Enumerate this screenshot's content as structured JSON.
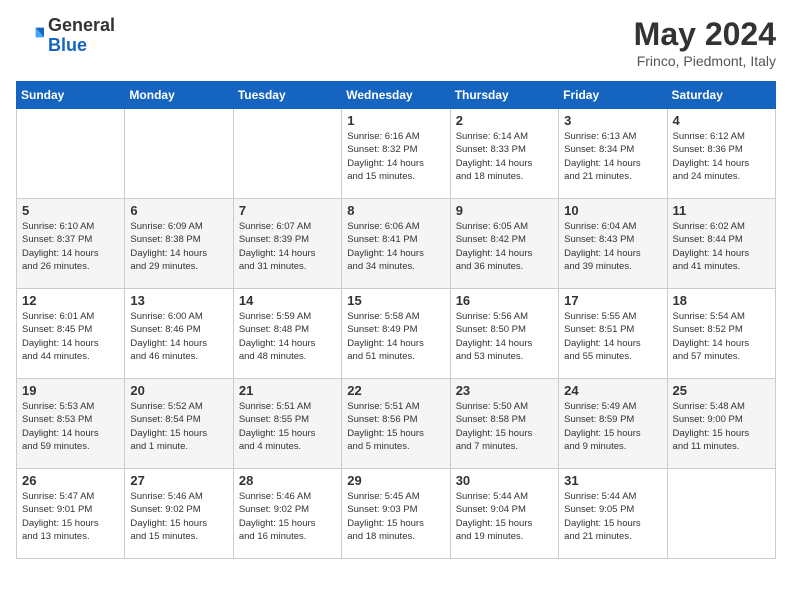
{
  "header": {
    "logo_general": "General",
    "logo_blue": "Blue",
    "month_title": "May 2024",
    "location": "Frinco, Piedmont, Italy"
  },
  "weekdays": [
    "Sunday",
    "Monday",
    "Tuesday",
    "Wednesday",
    "Thursday",
    "Friday",
    "Saturday"
  ],
  "weeks": [
    [
      {
        "day": "",
        "info": ""
      },
      {
        "day": "",
        "info": ""
      },
      {
        "day": "",
        "info": ""
      },
      {
        "day": "1",
        "info": "Sunrise: 6:16 AM\nSunset: 8:32 PM\nDaylight: 14 hours\nand 15 minutes."
      },
      {
        "day": "2",
        "info": "Sunrise: 6:14 AM\nSunset: 8:33 PM\nDaylight: 14 hours\nand 18 minutes."
      },
      {
        "day": "3",
        "info": "Sunrise: 6:13 AM\nSunset: 8:34 PM\nDaylight: 14 hours\nand 21 minutes."
      },
      {
        "day": "4",
        "info": "Sunrise: 6:12 AM\nSunset: 8:36 PM\nDaylight: 14 hours\nand 24 minutes."
      }
    ],
    [
      {
        "day": "5",
        "info": "Sunrise: 6:10 AM\nSunset: 8:37 PM\nDaylight: 14 hours\nand 26 minutes."
      },
      {
        "day": "6",
        "info": "Sunrise: 6:09 AM\nSunset: 8:38 PM\nDaylight: 14 hours\nand 29 minutes."
      },
      {
        "day": "7",
        "info": "Sunrise: 6:07 AM\nSunset: 8:39 PM\nDaylight: 14 hours\nand 31 minutes."
      },
      {
        "day": "8",
        "info": "Sunrise: 6:06 AM\nSunset: 8:41 PM\nDaylight: 14 hours\nand 34 minutes."
      },
      {
        "day": "9",
        "info": "Sunrise: 6:05 AM\nSunset: 8:42 PM\nDaylight: 14 hours\nand 36 minutes."
      },
      {
        "day": "10",
        "info": "Sunrise: 6:04 AM\nSunset: 8:43 PM\nDaylight: 14 hours\nand 39 minutes."
      },
      {
        "day": "11",
        "info": "Sunrise: 6:02 AM\nSunset: 8:44 PM\nDaylight: 14 hours\nand 41 minutes."
      }
    ],
    [
      {
        "day": "12",
        "info": "Sunrise: 6:01 AM\nSunset: 8:45 PM\nDaylight: 14 hours\nand 44 minutes."
      },
      {
        "day": "13",
        "info": "Sunrise: 6:00 AM\nSunset: 8:46 PM\nDaylight: 14 hours\nand 46 minutes."
      },
      {
        "day": "14",
        "info": "Sunrise: 5:59 AM\nSunset: 8:48 PM\nDaylight: 14 hours\nand 48 minutes."
      },
      {
        "day": "15",
        "info": "Sunrise: 5:58 AM\nSunset: 8:49 PM\nDaylight: 14 hours\nand 51 minutes."
      },
      {
        "day": "16",
        "info": "Sunrise: 5:56 AM\nSunset: 8:50 PM\nDaylight: 14 hours\nand 53 minutes."
      },
      {
        "day": "17",
        "info": "Sunrise: 5:55 AM\nSunset: 8:51 PM\nDaylight: 14 hours\nand 55 minutes."
      },
      {
        "day": "18",
        "info": "Sunrise: 5:54 AM\nSunset: 8:52 PM\nDaylight: 14 hours\nand 57 minutes."
      }
    ],
    [
      {
        "day": "19",
        "info": "Sunrise: 5:53 AM\nSunset: 8:53 PM\nDaylight: 14 hours\nand 59 minutes."
      },
      {
        "day": "20",
        "info": "Sunrise: 5:52 AM\nSunset: 8:54 PM\nDaylight: 15 hours\nand 1 minute."
      },
      {
        "day": "21",
        "info": "Sunrise: 5:51 AM\nSunset: 8:55 PM\nDaylight: 15 hours\nand 4 minutes."
      },
      {
        "day": "22",
        "info": "Sunrise: 5:51 AM\nSunset: 8:56 PM\nDaylight: 15 hours\nand 5 minutes."
      },
      {
        "day": "23",
        "info": "Sunrise: 5:50 AM\nSunset: 8:58 PM\nDaylight: 15 hours\nand 7 minutes."
      },
      {
        "day": "24",
        "info": "Sunrise: 5:49 AM\nSunset: 8:59 PM\nDaylight: 15 hours\nand 9 minutes."
      },
      {
        "day": "25",
        "info": "Sunrise: 5:48 AM\nSunset: 9:00 PM\nDaylight: 15 hours\nand 11 minutes."
      }
    ],
    [
      {
        "day": "26",
        "info": "Sunrise: 5:47 AM\nSunset: 9:01 PM\nDaylight: 15 hours\nand 13 minutes."
      },
      {
        "day": "27",
        "info": "Sunrise: 5:46 AM\nSunset: 9:02 PM\nDaylight: 15 hours\nand 15 minutes."
      },
      {
        "day": "28",
        "info": "Sunrise: 5:46 AM\nSunset: 9:02 PM\nDaylight: 15 hours\nand 16 minutes."
      },
      {
        "day": "29",
        "info": "Sunrise: 5:45 AM\nSunset: 9:03 PM\nDaylight: 15 hours\nand 18 minutes."
      },
      {
        "day": "30",
        "info": "Sunrise: 5:44 AM\nSunset: 9:04 PM\nDaylight: 15 hours\nand 19 minutes."
      },
      {
        "day": "31",
        "info": "Sunrise: 5:44 AM\nSunset: 9:05 PM\nDaylight: 15 hours\nand 21 minutes."
      },
      {
        "day": "",
        "info": ""
      }
    ]
  ]
}
